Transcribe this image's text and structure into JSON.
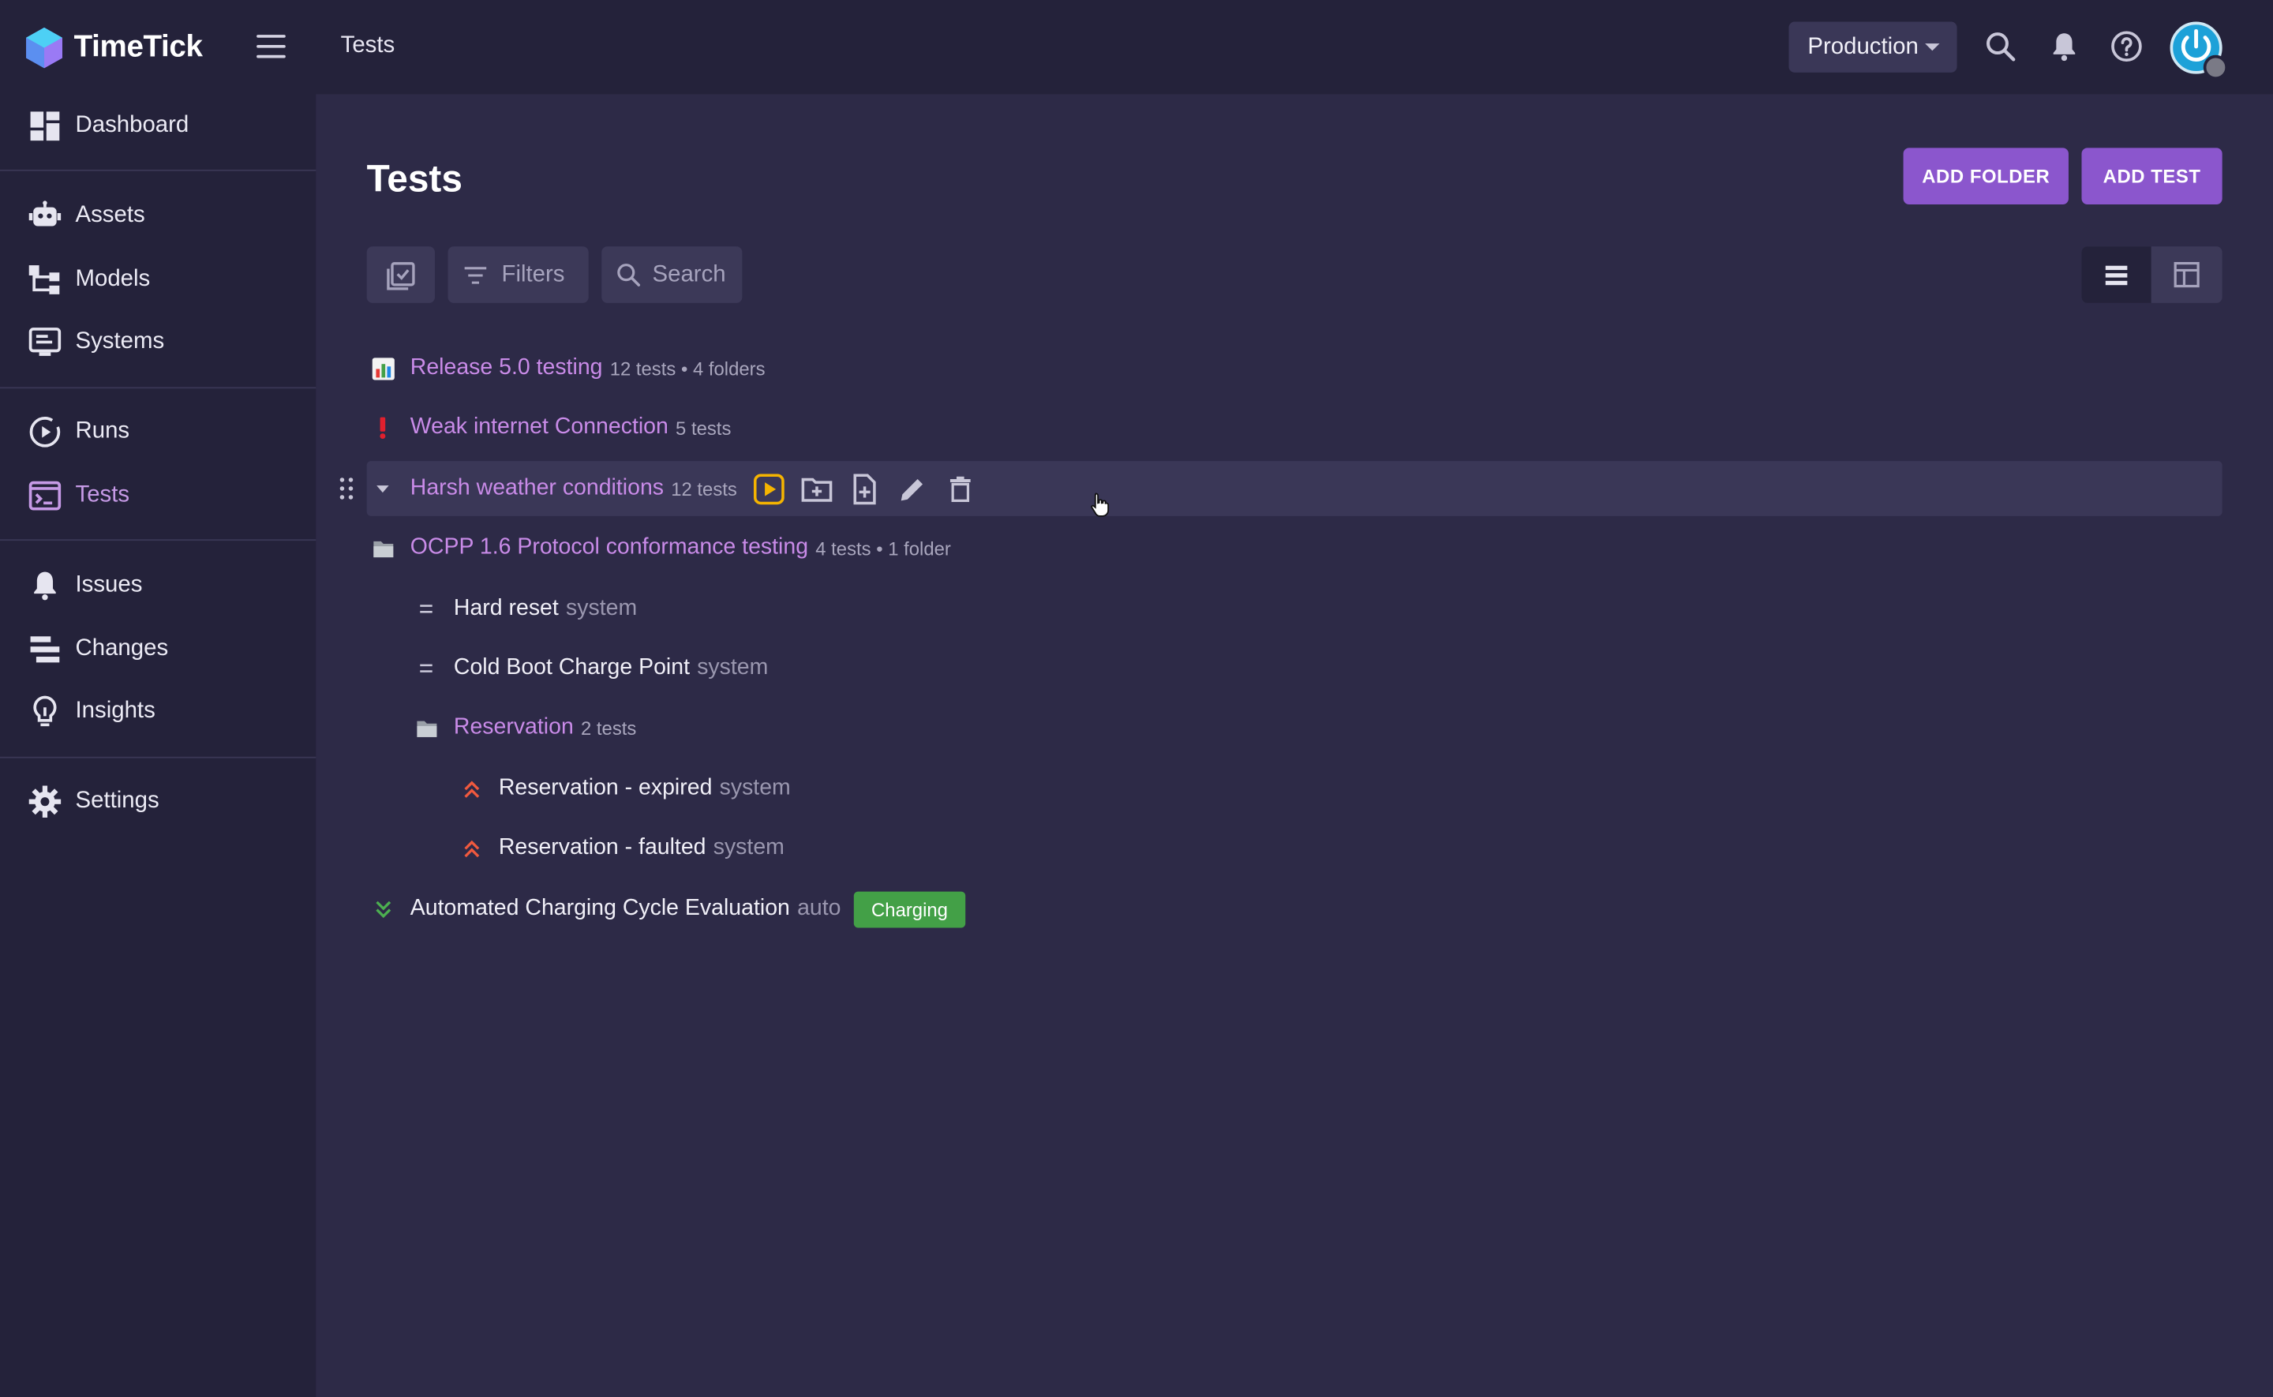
{
  "app": {
    "name": "TimeTick"
  },
  "topbar": {
    "breadcrumb": "Tests",
    "environment": "Production",
    "icons": [
      "search-icon",
      "bell-icon",
      "help-icon"
    ]
  },
  "sidebar": {
    "items": [
      {
        "label": "Dashboard",
        "icon": "dashboard-icon"
      },
      {
        "label": "Assets",
        "icon": "robot-icon"
      },
      {
        "label": "Models",
        "icon": "hierarchy-icon"
      },
      {
        "label": "Systems",
        "icon": "monitor-icon"
      },
      {
        "label": "Runs",
        "icon": "play-circle-icon"
      },
      {
        "label": "Tests",
        "icon": "terminal-icon",
        "active": true
      },
      {
        "label": "Issues",
        "icon": "bell-icon"
      },
      {
        "label": "Changes",
        "icon": "stack-icon"
      },
      {
        "label": "Insights",
        "icon": "lightbulb-icon"
      },
      {
        "label": "Settings",
        "icon": "gear-icon"
      }
    ]
  },
  "page": {
    "title": "Tests",
    "add_folder": "ADD FOLDER",
    "add_test": "ADD TEST",
    "filters": "Filters",
    "search": "Search"
  },
  "tree": [
    {
      "name": "Release 5.0 testing",
      "meta": "12 tests • 4 folders",
      "icon": "chart-icon",
      "kind": "folder"
    },
    {
      "name": "Weak internet Connection",
      "meta": "5 tests",
      "icon": "exclamation-icon",
      "kind": "folder"
    },
    {
      "name": "Harsh weather conditions",
      "meta": "12 tests",
      "icon": "caret-down-icon",
      "kind": "folder"
    },
    {
      "name": "OCPP 1.6 Protocol conformance testing",
      "meta": "4 tests • 1 folder",
      "icon": "folder-icon",
      "kind": "folder"
    },
    {
      "name": "Hard reset",
      "meta": "system",
      "icon": "equals-icon",
      "kind": "test"
    },
    {
      "name": "Cold Boot Charge Point",
      "meta": "system",
      "icon": "equals-icon",
      "kind": "test"
    },
    {
      "name": "Reservation",
      "meta": "2 tests",
      "icon": "folder-icon",
      "kind": "folder"
    },
    {
      "name": "Reservation - expired",
      "meta": "system",
      "icon": "double-chevron-up-icon",
      "kind": "test"
    },
    {
      "name": "Reservation - faulted",
      "meta": "system",
      "icon": "double-chevron-up-icon",
      "kind": "test"
    },
    {
      "name": "Automated Charging Cycle Evaluation",
      "meta": "auto",
      "icon": "double-chevron-down-icon",
      "kind": "test",
      "tag": "Charging"
    }
  ],
  "colors": {
    "accent": "#8b56cd",
    "folder_link": "#c98be8",
    "tag_green": "#43a047",
    "priority_high": "#f0593e",
    "priority_low": "#4caf50",
    "run_yellow": "#f5b400"
  }
}
